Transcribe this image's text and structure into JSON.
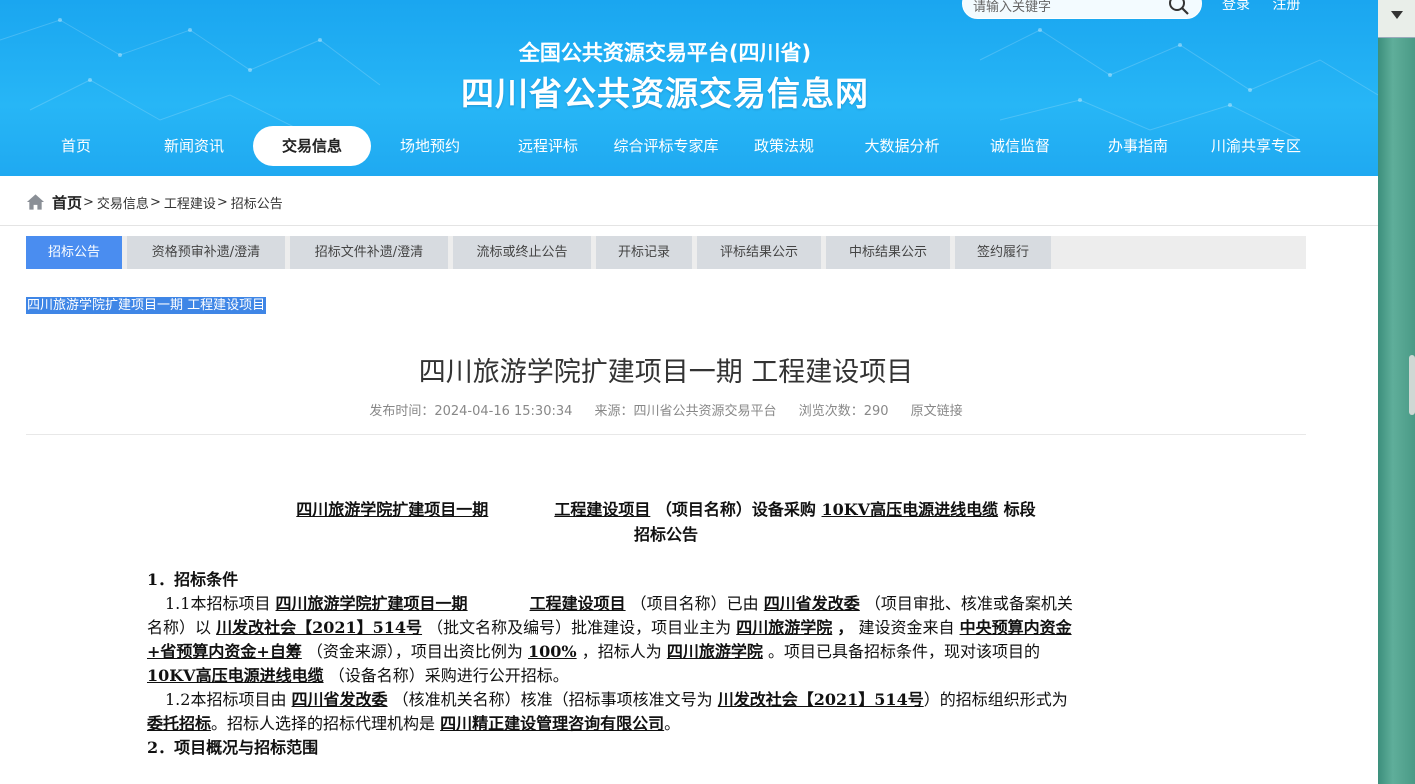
{
  "header": {
    "search_placeholder": "请输入关键字",
    "login": "登录",
    "register": "注册",
    "subtitle": "全国公共资源交易平台(四川省)",
    "title": "四川省公共资源交易信息网"
  },
  "nav": [
    "首页",
    "新闻资讯",
    "交易信息",
    "场地预约",
    "远程评标",
    "综合评标专家库",
    "政策法规",
    "大数据分析",
    "诚信监督",
    "办事指南",
    "川渝共享专区"
  ],
  "nav_active_index": 2,
  "breadcrumb": {
    "home": "首页",
    "items": [
      "交易信息",
      "工程建设",
      "招标公告"
    ],
    "sep": ">"
  },
  "subtabs": [
    "招标公告",
    "资格预审补遗/澄清",
    "招标文件补遗/澄清",
    "流标或终止公告",
    "开标记录",
    "评标结果公示",
    "中标结果公示",
    "签约履行"
  ],
  "subtab_active_index": 0,
  "selected_text": "四川旅游学院扩建项目一期 工程建设项目",
  "article": {
    "title": "四川旅游学院扩建项目一期 工程建设项目",
    "meta_time": "发布时间：2024-04-16 15:30:34",
    "meta_source": "来源：四川省公共资源交易平台",
    "meta_views": "浏览次数：290",
    "meta_link": "原文链接"
  },
  "doc": {
    "head1": {
      "project": "四川旅游学院扩建项目一期",
      "project_type": "工程建设项目",
      "label1": "（项目名称）设备采购",
      "equipment": "10KV高压电源进线电缆",
      "label2": "标段"
    },
    "head2": "招标公告",
    "s1_title": "1．招标条件",
    "p1": {
      "t1": "1.1本招标项目",
      "project": "四川旅游学院扩建项目一期",
      "project_type": "工程建设项目",
      "t2": "（项目名称）已由",
      "approver": "四川省发改委",
      "t3": "（项目审批、核准或备案机关",
      "t4": "名称）以",
      "doc_no": "川发改社会【2021】514号",
      "t5": "（批文名称及编号）批准建设，项目业主为",
      "owner": "四川旅游学院",
      "t6": "，",
      "t7": "建设资金来自",
      "fund_a": "中央预算内资金",
      "fund_b": "+省预算内资金+自筹",
      "t8": "（资金来源），项目出资比例为",
      "ratio": "100%",
      "t9": "，招标人为",
      "tenderer": "四川旅游学院",
      "t10": "。项目已具备招标条件，现对该项目的",
      "equipment": "10KV高压电源进线电缆",
      "t11": "（设备名称）采购进行公开招标。"
    },
    "p2": {
      "t1": "1.2本招标项目由",
      "approver": "四川省发改委",
      "t2": "（核准机关名称）核准（招标事项核准文号为",
      "doc_no": "川发改社会【2021】514号",
      "t3": "）的招标组织形式为",
      "form": "委托招标",
      "t4": "。招标人选择的招标代理机构是",
      "agency": "四川精正建设管理咨询有限公司",
      "t5": "。"
    },
    "s2_title": "2．项目概况与招标范围"
  },
  "colors": {
    "header_blue": "#1fa9f1",
    "tab_active": "#4a8df0",
    "selection": "#3f86e6"
  }
}
